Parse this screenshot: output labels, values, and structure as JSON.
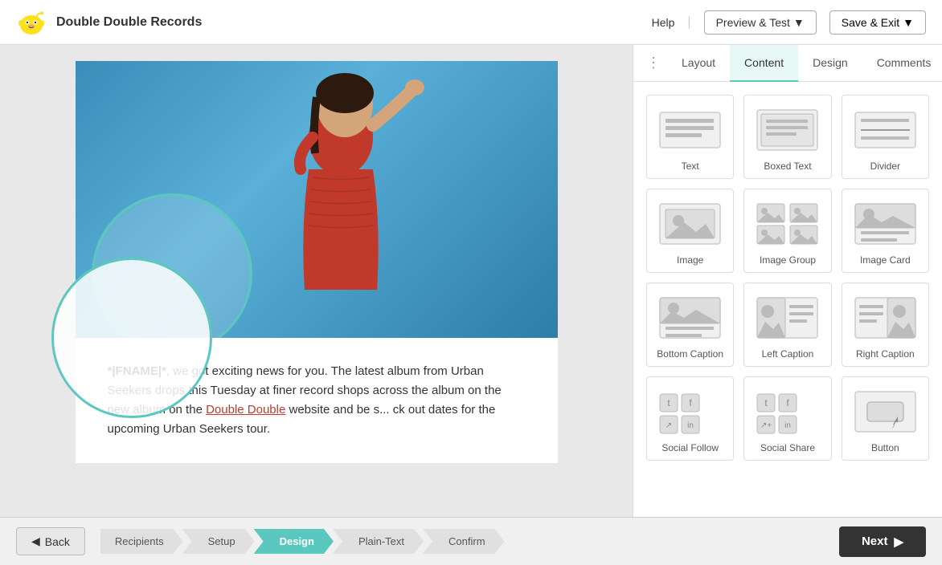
{
  "header": {
    "logo_alt": "Mailchimp",
    "app_title": "Double Double Records",
    "help_label": "Help",
    "preview_label": "Preview & Test",
    "save_label": "Save & Exit"
  },
  "panel": {
    "dots": "⋮",
    "tabs": [
      {
        "id": "layout",
        "label": "Layout"
      },
      {
        "id": "content",
        "label": "Content"
      },
      {
        "id": "design",
        "label": "Design"
      },
      {
        "id": "comments",
        "label": "Comments"
      }
    ],
    "active_tab": "content",
    "content_items": [
      {
        "id": "text",
        "label": "Text"
      },
      {
        "id": "boxed-text",
        "label": "Boxed Text"
      },
      {
        "id": "divider",
        "label": "Divider"
      },
      {
        "id": "image",
        "label": "Image"
      },
      {
        "id": "image-group",
        "label": "Image Group"
      },
      {
        "id": "image-card",
        "label": "Image Card"
      },
      {
        "id": "bottom-caption",
        "label": "Bottom Caption"
      },
      {
        "id": "left-caption",
        "label": "Left Caption"
      },
      {
        "id": "right-caption",
        "label": "Right Caption"
      },
      {
        "id": "social-follow",
        "label": "Social Follow"
      },
      {
        "id": "social-share",
        "label": "Social Share"
      },
      {
        "id": "button",
        "label": "Button"
      }
    ]
  },
  "email_content": {
    "body_text": "*|FNAME|*, we got exciting news for you. The latest album from Urban Seekers drops this Tuesday at finer record shops across the album on the new album on the Double Double website and be s... ck out dates for the upcoming Urban Seekers tour.",
    "link_text": "Double Double"
  },
  "footer": {
    "back_label": "Back",
    "steps": [
      {
        "id": "recipients",
        "label": "Recipients",
        "state": "default"
      },
      {
        "id": "setup",
        "label": "Setup",
        "state": "default"
      },
      {
        "id": "design",
        "label": "Design",
        "state": "active"
      },
      {
        "id": "plain-text",
        "label": "Plain-Text",
        "state": "default"
      },
      {
        "id": "confirm",
        "label": "Confirm",
        "state": "default"
      }
    ],
    "next_label": "Next"
  }
}
